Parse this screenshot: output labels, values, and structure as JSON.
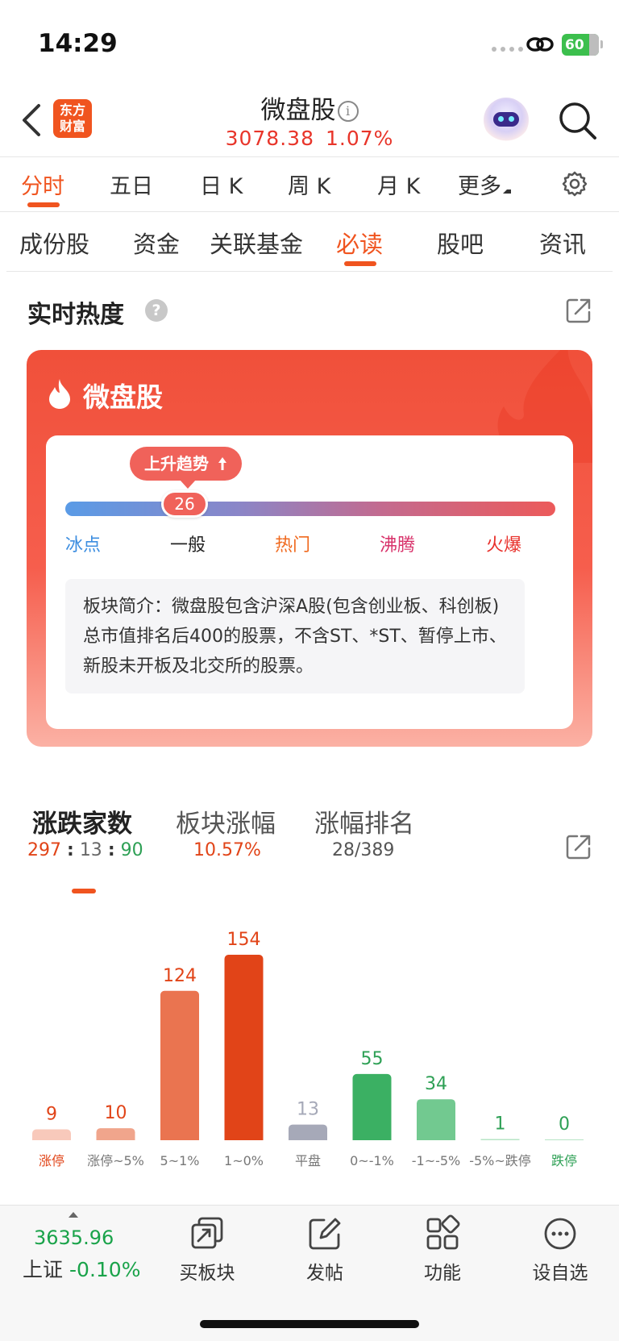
{
  "status_bar": {
    "time": "14:29",
    "battery": "60"
  },
  "header": {
    "logo_line1": "东方",
    "logo_line2": "财富",
    "title": "微盘股",
    "price": "3078.38",
    "change": "1.07%"
  },
  "period_tabs": [
    "分时",
    "五日",
    "日 K",
    "周 K",
    "月 K",
    "更多"
  ],
  "sub_tabs": [
    "成份股",
    "资金",
    "关联基金",
    "必读",
    "股吧",
    "资讯"
  ],
  "heat": {
    "section_title": "实时热度",
    "help": "?",
    "sector_name": "微盘股",
    "trend": "上升趋势",
    "score": "26",
    "levels": [
      "冰点",
      "一般",
      "热门",
      "沸腾",
      "火爆"
    ],
    "level_colors": [
      "#3d8ee0",
      "#222222",
      "#f06a1f",
      "#d8326a",
      "#e8302a"
    ],
    "intro_label": "板块简介：",
    "intro_text": "微盘股包含沪深A股(包含创业板、科创板)总市值排名后400的股票，不含ST、*ST、暂停上市、新股未开板及北交所的股票。"
  },
  "rise_fall": {
    "tabs": [
      "涨跌家数",
      "板块涨幅",
      "涨幅排名"
    ],
    "up": "297",
    "sep1": ":",
    "flat": "13",
    "sep2": ":",
    "down": "90",
    "sector_change": "10.57%",
    "rank": "28/389"
  },
  "chart_data": {
    "type": "bar",
    "categories": [
      "涨停",
      "涨停~5%",
      "5~1%",
      "1~0%",
      "平盘",
      "0~-1%",
      "-1~-5%",
      "-5%~跌停",
      "跌停"
    ],
    "values": [
      9,
      10,
      124,
      154,
      13,
      55,
      34,
      1,
      0
    ],
    "colors": [
      "#f8c9bb",
      "#f0a58c",
      "#ea7450",
      "#e14418",
      "#a6a9b8",
      "#3bb063",
      "#72c990",
      "#b7e4c6",
      "#b7e4c6"
    ],
    "value_colors": [
      "#e14418",
      "#e14418",
      "#e14418",
      "#e14418",
      "#a6a9b8",
      "#2ea055",
      "#2ea055",
      "#2ea055",
      "#2ea055"
    ],
    "label_colors": [
      "#e14418",
      "#777777",
      "#777777",
      "#777777",
      "#777777",
      "#777777",
      "#777777",
      "#777777",
      "#2ea055"
    ]
  },
  "bottom_bar": {
    "index_value": "3635.96",
    "index_name": "上证",
    "index_change": "-0.10%",
    "items": [
      "买板块",
      "发帖",
      "功能",
      "设自选"
    ]
  }
}
